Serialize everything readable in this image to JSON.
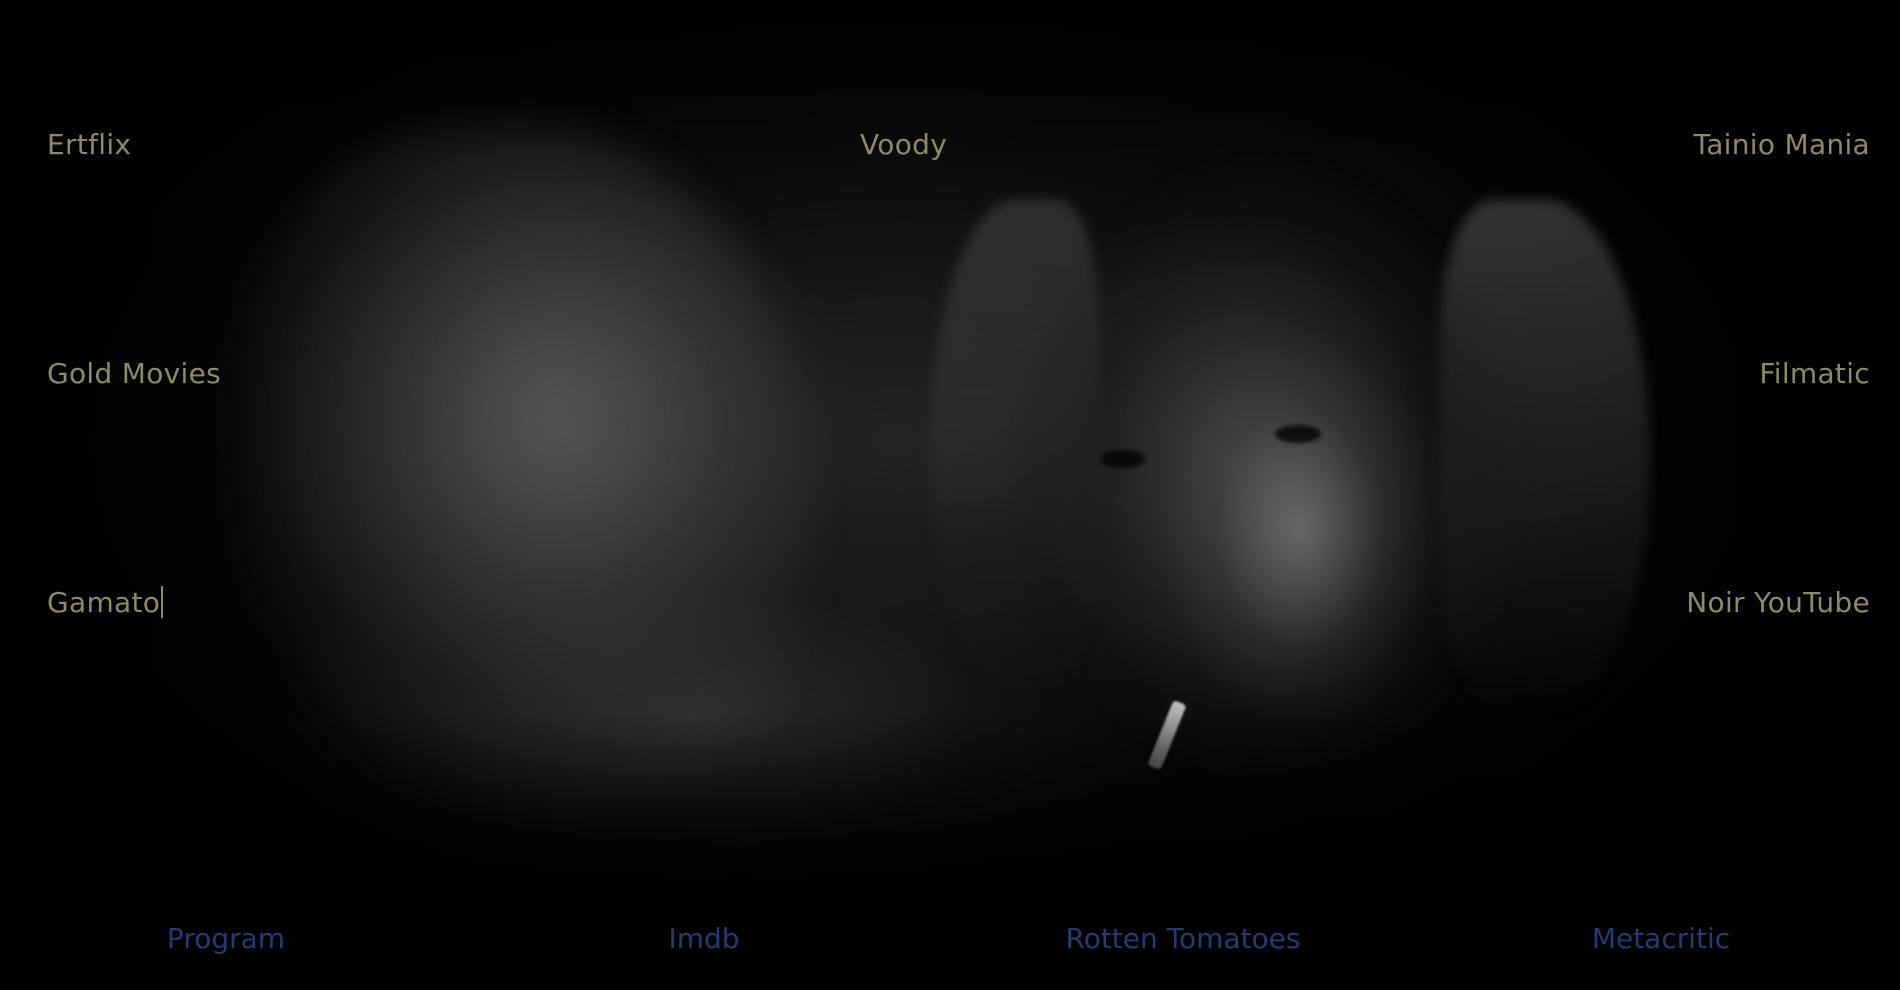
{
  "sites": {
    "ertflix": "Ertflix",
    "voody": "Voody",
    "tainio_mania": "Tainio Mania",
    "gold_movies": "Gold Movies",
    "filmatic": "Filmatic",
    "gamato": "Gamato",
    "noir_youtube": "Noir YouTube"
  },
  "footer": {
    "program": "Program",
    "imdb": "Imdb",
    "rotten_tomatoes": "Rotten Tomatoes",
    "metacritic": "Metacritic"
  },
  "colors": {
    "site_link": "#8c8a64",
    "footer_link": "#253a72",
    "background": "#000000"
  },
  "background_image": "black-and-white photo of a woman with a cigarette and smoke"
}
